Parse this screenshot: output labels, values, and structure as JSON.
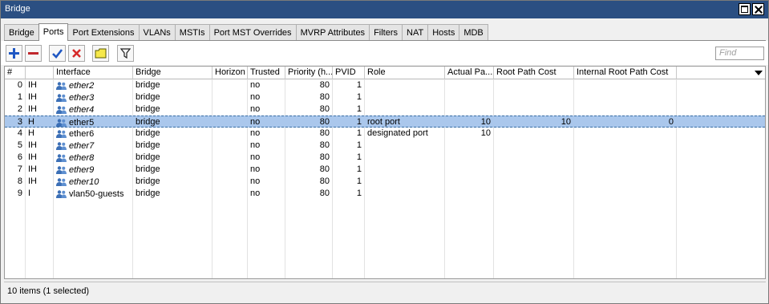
{
  "window": {
    "title": "Bridge"
  },
  "tabs": [
    {
      "label": "Bridge",
      "active": false
    },
    {
      "label": "Ports",
      "active": true
    },
    {
      "label": "Port Extensions",
      "active": false
    },
    {
      "label": "VLANs",
      "active": false
    },
    {
      "label": "MSTIs",
      "active": false
    },
    {
      "label": "Port MST Overrides",
      "active": false
    },
    {
      "label": "MVRP Attributes",
      "active": false
    },
    {
      "label": "Filters",
      "active": false
    },
    {
      "label": "NAT",
      "active": false
    },
    {
      "label": "Hosts",
      "active": false
    },
    {
      "label": "MDB",
      "active": false
    }
  ],
  "toolbar": {
    "buttons": [
      "add-icon",
      "remove-icon",
      "enable-icon",
      "disable-icon",
      "comment-icon",
      "filter-icon"
    ],
    "find_placeholder": "Find"
  },
  "table": {
    "columns": [
      "#",
      "",
      "Interface",
      "Bridge",
      "Horizon",
      "Trusted",
      "Priority (h...",
      "PVID",
      "Role",
      "Actual Pa...",
      "Root Path Cost",
      "Internal Root Path Cost"
    ],
    "rows": [
      {
        "num": "0",
        "flags": "IH",
        "interface": "ether2",
        "dynamic": true,
        "bridge": "bridge",
        "horizon": "",
        "trusted": "no",
        "priority": "80",
        "pvid": "1",
        "role": "",
        "actual": "",
        "root_cost": "",
        "internal_cost": "",
        "selected": false
      },
      {
        "num": "1",
        "flags": "IH",
        "interface": "ether3",
        "dynamic": true,
        "bridge": "bridge",
        "horizon": "",
        "trusted": "no",
        "priority": "80",
        "pvid": "1",
        "role": "",
        "actual": "",
        "root_cost": "",
        "internal_cost": "",
        "selected": false
      },
      {
        "num": "2",
        "flags": "IH",
        "interface": "ether4",
        "dynamic": true,
        "bridge": "bridge",
        "horizon": "",
        "trusted": "no",
        "priority": "80",
        "pvid": "1",
        "role": "",
        "actual": "",
        "root_cost": "",
        "internal_cost": "",
        "selected": false
      },
      {
        "num": "3",
        "flags": "H",
        "interface": "ether5",
        "dynamic": false,
        "bridge": "bridge",
        "horizon": "",
        "trusted": "no",
        "priority": "80",
        "pvid": "1",
        "role": "root port",
        "actual": "10",
        "root_cost": "10",
        "internal_cost": "0",
        "selected": true
      },
      {
        "num": "4",
        "flags": "H",
        "interface": "ether6",
        "dynamic": false,
        "bridge": "bridge",
        "horizon": "",
        "trusted": "no",
        "priority": "80",
        "pvid": "1",
        "role": "designated port",
        "actual": "10",
        "root_cost": "",
        "internal_cost": "",
        "selected": false
      },
      {
        "num": "5",
        "flags": "IH",
        "interface": "ether7",
        "dynamic": true,
        "bridge": "bridge",
        "horizon": "",
        "trusted": "no",
        "priority": "80",
        "pvid": "1",
        "role": "",
        "actual": "",
        "root_cost": "",
        "internal_cost": "",
        "selected": false
      },
      {
        "num": "6",
        "flags": "IH",
        "interface": "ether8",
        "dynamic": true,
        "bridge": "bridge",
        "horizon": "",
        "trusted": "no",
        "priority": "80",
        "pvid": "1",
        "role": "",
        "actual": "",
        "root_cost": "",
        "internal_cost": "",
        "selected": false
      },
      {
        "num": "7",
        "flags": "IH",
        "interface": "ether9",
        "dynamic": true,
        "bridge": "bridge",
        "horizon": "",
        "trusted": "no",
        "priority": "80",
        "pvid": "1",
        "role": "",
        "actual": "",
        "root_cost": "",
        "internal_cost": "",
        "selected": false
      },
      {
        "num": "8",
        "flags": "IH",
        "interface": "ether10",
        "dynamic": true,
        "bridge": "bridge",
        "horizon": "",
        "trusted": "no",
        "priority": "80",
        "pvid": "1",
        "role": "",
        "actual": "",
        "root_cost": "",
        "internal_cost": "",
        "selected": false
      },
      {
        "num": "9",
        "flags": "I",
        "interface": "vlan50-guests",
        "dynamic": false,
        "bridge": "bridge",
        "horizon": "",
        "trusted": "no",
        "priority": "80",
        "pvid": "1",
        "role": "",
        "actual": "",
        "root_cost": "",
        "internal_cost": "",
        "selected": false
      }
    ]
  },
  "status": {
    "text": "10 items (1 selected)"
  },
  "colors": {
    "titlebar": "#2b4f82",
    "selection": "#aac7ec",
    "icon_blue": "#3b6fb6",
    "add_blue": "#1f57c3",
    "remove_red": "#c0282d",
    "enable_blue": "#1f57c3",
    "disable_red": "#d62a2a",
    "comment_yellow": "#f6e84a"
  }
}
